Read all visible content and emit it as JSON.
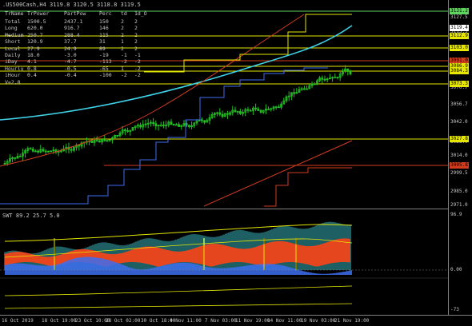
{
  "title": ".US500Cash,H4  3119.8 3120.5 3118.8 3119.5",
  "table": {
    "headers": [
      "TrName",
      "TrPower",
      "PartPow",
      "Perc",
      "td",
      "1d_O"
    ],
    "rows": [
      [
        "Total",
        "1500.5",
        "2437.1",
        "150",
        "2",
        "2"
      ],
      [
        "Long",
        "620.0",
        "916.7",
        "146",
        "2",
        "2"
      ],
      [
        "Medium",
        "250.7",
        "288.4",
        "115",
        "2",
        "2"
      ],
      [
        "Short",
        "120.9",
        "37.7",
        "31",
        "1",
        "2"
      ],
      [
        "Local",
        "27.9",
        "24.9",
        "89",
        "2",
        "2"
      ],
      [
        "Daily",
        "18.0",
        "-3.0",
        "-19",
        "-1",
        "-1"
      ],
      [
        "iDay",
        "4.1",
        "-4.7",
        "-113",
        "-2",
        "-2"
      ],
      [
        "Hourly",
        "0.8",
        "-0.5",
        "-65",
        "1",
        "-2"
      ],
      [
        "iHour",
        "0.4",
        "-0.4",
        "-100",
        "-2",
        "-2"
      ]
    ],
    "footer": "V=2.8"
  },
  "price_axis": {
    "labels": [
      "3127.5",
      "3113.5",
      "3099.5",
      "3085.6",
      "3070.7",
      "3056.7",
      "3042.0",
      "3028.0",
      "3014.0",
      "2999.5",
      "2985.0",
      "2971.0"
    ],
    "tags": [
      {
        "text": "3131.2",
        "color": "#5fd35f"
      },
      {
        "text": "3119.4",
        "color": "#ffffff"
      },
      {
        "text": "3112.9",
        "color": "#e6e600"
      },
      {
        "text": "3103.0",
        "color": "#e6e600"
      },
      {
        "text": "3091.0",
        "color": "#d23c1e"
      },
      {
        "text": "3086.9",
        "color": "#e6e600"
      },
      {
        "text": "3084.3",
        "color": "#e6e600"
      },
      {
        "text": "3073.3",
        "color": "#e6e600"
      },
      {
        "text": "3027.8",
        "color": "#e6e600"
      },
      {
        "text": "3005.8",
        "color": "#d23c1e"
      }
    ]
  },
  "oscillator": {
    "title": "SWT 89.2 25.7 5.0",
    "axis_labels": [
      "96.9",
      "0.00",
      "-73"
    ]
  },
  "time_axis": [
    "16 Oct 2019",
    "18 Oct 19:00",
    "23 Oct 10:00",
    "28 Oct 02:00",
    "30 Oct 18:00",
    "4 Nov 11:00",
    "7 Nov 03:00",
    "11 Nov 19:00",
    "14 Nov 11:00",
    "19 Nov 03:00",
    "21 Nov 19:00"
  ],
  "colors": {
    "bull": "#22c022",
    "bear": "#22c022",
    "ma": "#3ed2e6",
    "yellow": "#e6e600",
    "red": "#d23c1e",
    "blue": "#3c6ef0",
    "osc_fill": "#e6461e",
    "osc_cyan": "#3cbec8"
  }
}
